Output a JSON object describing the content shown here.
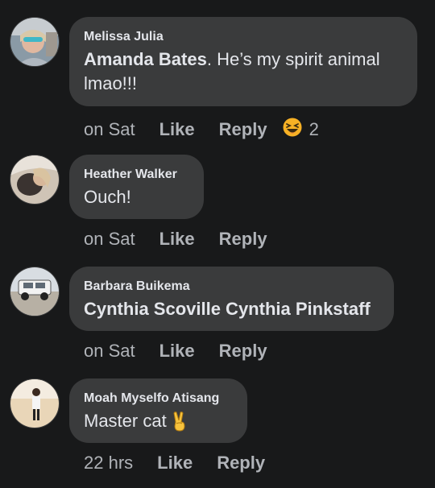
{
  "comments": [
    {
      "author": "Melissa Julia",
      "mention": "Amanda Bates",
      "text_after_mention": ". He’s my spirit animal",
      "text_line2": "lmao!!!",
      "time": "on Sat",
      "like_label": "Like",
      "reply_label": "Reply",
      "reaction_icon": "laughing-emoji",
      "reaction_count": "2"
    },
    {
      "author": "Heather Walker",
      "text": "Ouch!",
      "time": "on Sat",
      "like_label": "Like",
      "reply_label": "Reply"
    },
    {
      "author": "Barbara Buikema",
      "text": "Cynthia Scoville Cynthia Pinkstaff",
      "time": "on Sat",
      "like_label": "Like",
      "reply_label": "Reply"
    },
    {
      "author": "Moah Myselfo Atisang",
      "text": "Master cat",
      "text_emoji": "victory-hand-emoji",
      "time": "22 hrs",
      "like_label": "Like",
      "reply_label": "Reply"
    }
  ],
  "colors": {
    "background": "#18191a",
    "bubble": "#3a3b3c",
    "primary_text": "#e4e6eb",
    "secondary_text": "#b0b3b8",
    "reaction_yellow": "#f7b125"
  }
}
